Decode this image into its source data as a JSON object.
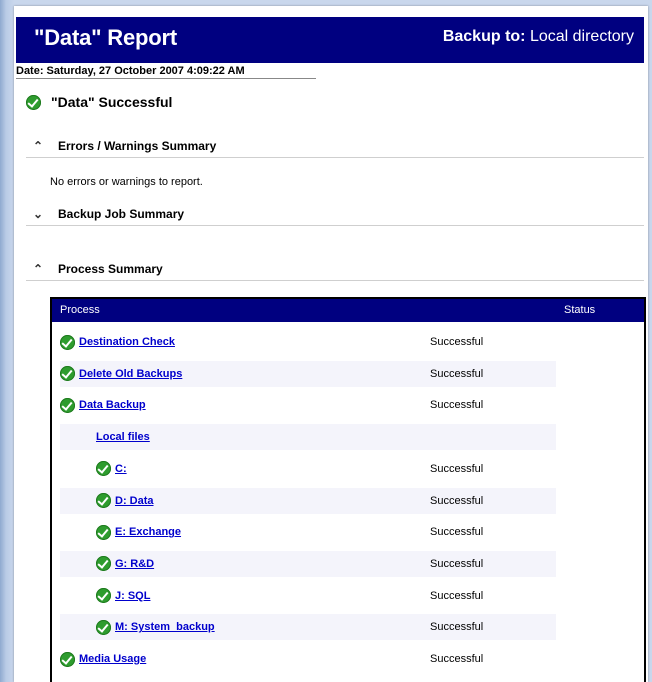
{
  "header": {
    "title": "\"Data\" Report",
    "backup_label": "Backup to:",
    "backup_value": "Local directory"
  },
  "date_line": "Date: Saturday, 27 October 2007 4:09:22 AM",
  "overall_status": "\"Data\" Successful",
  "sections": {
    "errors": "Errors / Warnings Summary",
    "backup_job": "Backup Job Summary",
    "process": "Process Summary"
  },
  "errors_note": "No errors or warnings to report.",
  "table": {
    "col_process": "Process",
    "col_status": "Status",
    "rows": [
      {
        "name": "Destination Check",
        "status": "Successful",
        "indent": 0,
        "check": true
      },
      {
        "name": "Delete Old Backups",
        "status": "Successful",
        "indent": 0,
        "check": true
      },
      {
        "name": "Data Backup",
        "status": "Successful",
        "indent": 0,
        "check": true
      },
      {
        "name": "Local files",
        "status": "",
        "indent": 1,
        "check": false
      },
      {
        "name": "C:",
        "status": "Successful",
        "indent": 2,
        "check": true
      },
      {
        "name": "D: Data",
        "status": "Successful",
        "indent": 2,
        "check": true
      },
      {
        "name": "E: Exchange",
        "status": "Successful",
        "indent": 2,
        "check": true
      },
      {
        "name": "G: R&D",
        "status": "Successful",
        "indent": 2,
        "check": true
      },
      {
        "name": "J: SQL",
        "status": "Successful",
        "indent": 2,
        "check": true
      },
      {
        "name": "M: System_backup",
        "status": "Successful",
        "indent": 2,
        "check": true
      },
      {
        "name": "Media Usage",
        "status": "Successful",
        "indent": 0,
        "check": true
      }
    ]
  },
  "icons": {
    "success": "check-circle-icon",
    "collapse": "double-chevron-up-icon",
    "expand": "double-chevron-down-icon"
  }
}
